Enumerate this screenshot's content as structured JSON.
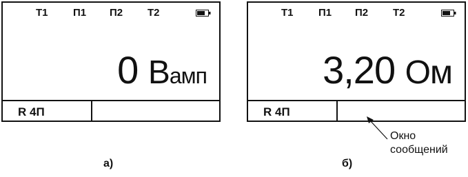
{
  "screens": [
    {
      "indicators": [
        "Т1",
        "П1",
        "П2",
        "Т2"
      ],
      "battery_icon": "battery-icon",
      "value": "0",
      "unit_big": "В",
      "unit_small": "амп",
      "mode": "R 4П",
      "caption": "а)"
    },
    {
      "indicators": [
        "Т1",
        "П1",
        "П2",
        "Т2"
      ],
      "battery_icon": "battery-icon",
      "value": "3,20",
      "unit_big": "Ом",
      "unit_small": "",
      "mode": "R 4П",
      "caption": "б)"
    }
  ],
  "callout": {
    "line1": "Окно",
    "line2": "сообщений"
  }
}
